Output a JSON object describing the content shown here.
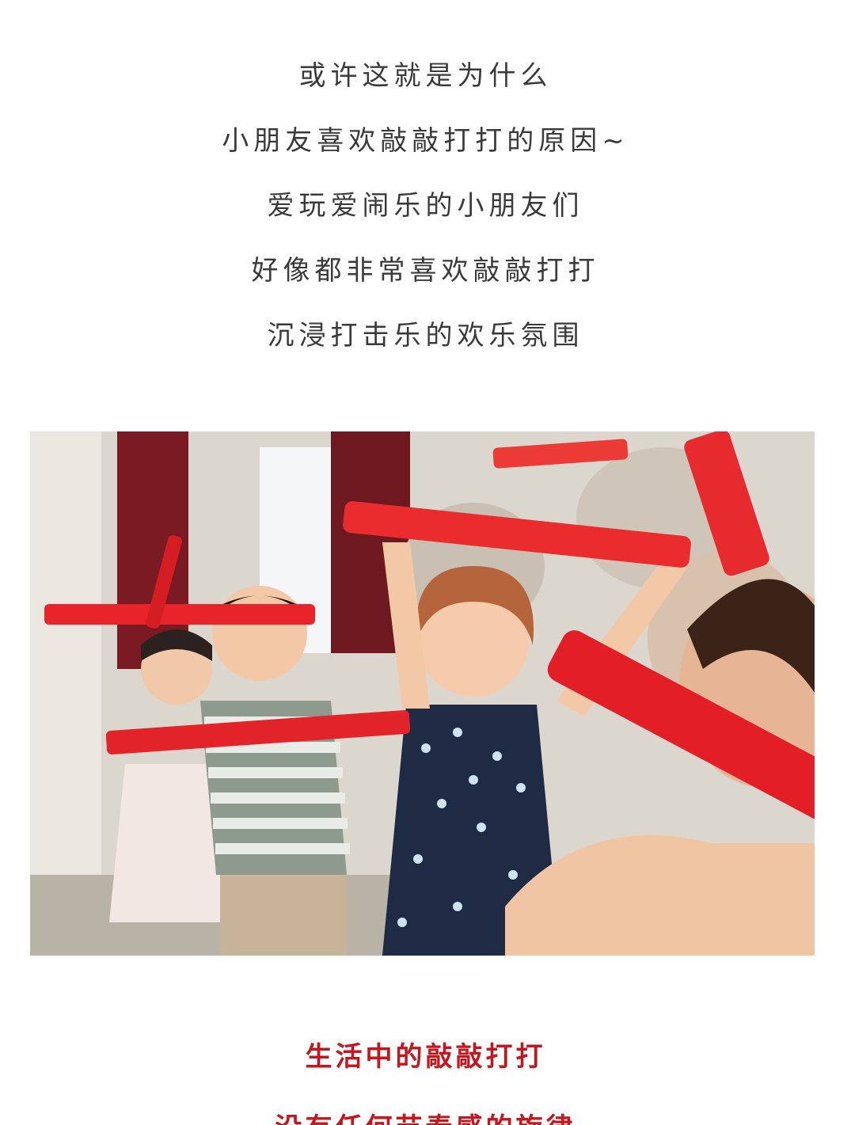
{
  "article": {
    "intro_lines": [
      "或许这就是为什么",
      "小朋友喜欢敲敲打打的原因~",
      "爱玩爱闹乐的小朋友们",
      "好像都非常喜欢敲敲打打",
      "沉浸打击乐的欢乐氛围"
    ],
    "photo": {
      "colors": {
        "tube_red": "#e8242a",
        "wall": "#d8d3c9",
        "curtain": "#7a1a22",
        "skin": "#f2c7a5"
      }
    },
    "highlight_lines": [
      "生活中的敲敲打打",
      "没有任何节奏感的旋律"
    ]
  }
}
